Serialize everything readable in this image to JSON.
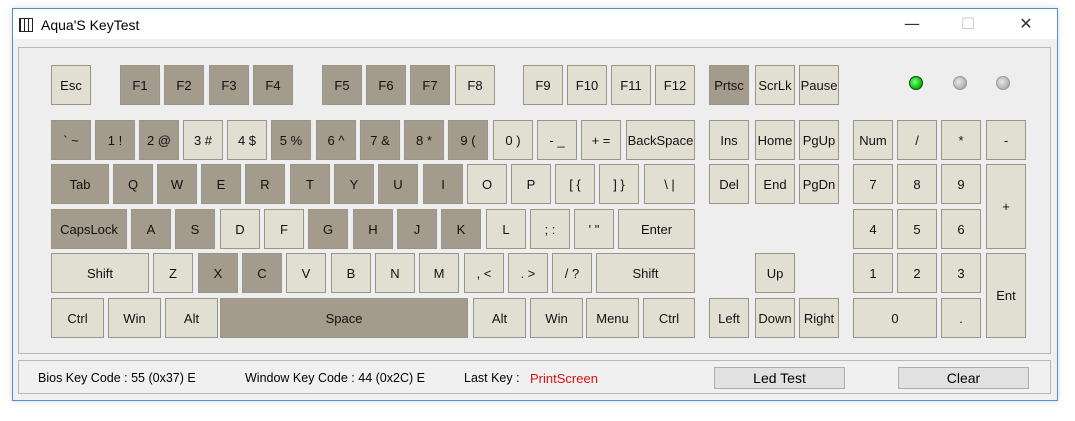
{
  "window": {
    "title": "Aqua'S KeyTest",
    "minimize": "—",
    "maximize": "☐",
    "close": "✕"
  },
  "colors": {
    "pressed": "#a39b8c",
    "unpressed": "#e1ded2",
    "led_on": "#10c010",
    "led_off": "#b8b8b8",
    "last_key": "#e01010"
  },
  "keys": {
    "esc": "Esc",
    "f1": "F1",
    "f2": "F2",
    "f3": "F3",
    "f4": "F4",
    "f5": "F5",
    "f6": "F6",
    "f7": "F7",
    "f8": "F8",
    "f9": "F9",
    "f10": "F10",
    "f11": "F11",
    "f12": "F12",
    "prtsc": "Prtsc",
    "scrlk": "ScrLk",
    "pause": "Pause",
    "backtick": "` ~",
    "n1": "1 !",
    "n2": "2 @",
    "n3": "3 #",
    "n4": "4 $",
    "n5": "5 %",
    "n6": "6 ^",
    "n7": "7 &",
    "n8": "8 *",
    "n9": "9 (",
    "n0": "0 )",
    "minus": "- _",
    "equal": "+ =",
    "backspace": "BackSpace",
    "tab": "Tab",
    "q": "Q",
    "w": "W",
    "e": "E",
    "r": "R",
    "t": "T",
    "y": "Y",
    "u": "U",
    "i": "I",
    "o": "O",
    "p": "P",
    "lbracket": "[ {",
    "rbracket": "] }",
    "backslash": "\\ |",
    "capslock": "CapsLock",
    "a": "A",
    "s": "S",
    "d": "D",
    "f": "F",
    "g": "G",
    "h": "H",
    "j": "J",
    "k": "K",
    "l": "L",
    "semicolon": "; :",
    "quote": "' \"",
    "enter": "Enter",
    "lshift": "Shift",
    "z": "Z",
    "x": "X",
    "c": "C",
    "v": "V",
    "b": "B",
    "n": "N",
    "m": "M",
    "comma": ", <",
    "period": ". >",
    "slash": "/ ?",
    "rshift": "Shift",
    "lctrl": "Ctrl",
    "lwin": "Win",
    "lalt": "Alt",
    "space": "Space",
    "ralt": "Alt",
    "rwin": "Win",
    "menu": "Menu",
    "rctrl": "Ctrl",
    "ins": "Ins",
    "home": "Home",
    "pgup": "PgUp",
    "del": "Del",
    "end": "End",
    "pgdn": "PgDn",
    "up": "Up",
    "left": "Left",
    "down": "Down",
    "right": "Right",
    "num": "Num",
    "kp_slash": "/",
    "kp_star": "*",
    "kp_minus": "-",
    "kp7": "7",
    "kp8": "8",
    "kp9": "9",
    "kp_plus": "+",
    "kp4": "4",
    "kp5": "5",
    "kp6": "6",
    "kp1": "1",
    "kp2": "2",
    "kp3": "3",
    "kp_enter": "Ent",
    "kp0": "0",
    "kp_dot": "."
  },
  "leds": [
    "on",
    "off",
    "off"
  ],
  "status": {
    "bios_code": "Bios Key Code : 55 (0x37) E",
    "window_code": "Window Key Code : 44 (0x2C) E",
    "last_key_label": "Last Key :",
    "last_key_value": "PrintScreen",
    "led_test": "Led Test",
    "clear": "Clear"
  }
}
